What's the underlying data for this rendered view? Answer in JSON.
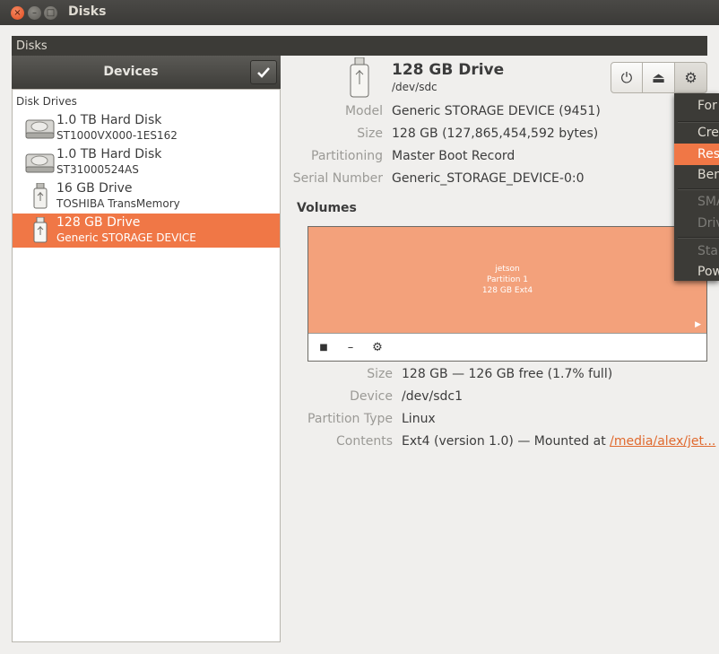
{
  "window": {
    "title": "Disks",
    "close_glyph": "×",
    "min_glyph": "–",
    "max_glyph": "□"
  },
  "menubar": {
    "app_label": "Disks"
  },
  "devices": {
    "header": "Devices",
    "section_label": "Disk Drives",
    "items": [
      {
        "name": "1.0 TB Hard Disk",
        "sub": "ST1000VX000-1ES162",
        "icon": "hard-disk-icon"
      },
      {
        "name": "1.0 TB Hard Disk",
        "sub": "ST31000524AS",
        "icon": "hard-disk-icon"
      },
      {
        "name": "16 GB Drive",
        "sub": "TOSHIBA TransMemory",
        "icon": "usb-drive-icon"
      },
      {
        "name": "128 GB Drive",
        "sub": "Generic STORAGE DEVICE",
        "icon": "usb-drive-icon",
        "selected": true
      }
    ]
  },
  "drive": {
    "title": "128 GB Drive",
    "path": "/dev/sdc",
    "fields": [
      {
        "label": "Model",
        "value": "Generic STORAGE DEVICE (9451)"
      },
      {
        "label": "Size",
        "value": "128 GB (127,865,454,592 bytes)"
      },
      {
        "label": "Partitioning",
        "value": "Master Boot Record"
      },
      {
        "label": "Serial Number",
        "value": "Generic_STORAGE_DEVICE-0:0"
      }
    ]
  },
  "toolbar": {
    "power_glyph": "⏻",
    "eject_glyph": "⏏",
    "gear_glyph": "⚙"
  },
  "volumes": {
    "title": "Volumes",
    "partition": {
      "name": "jetson",
      "label": "Partition 1",
      "fs": "128 GB Ext4",
      "arrow": "▶"
    },
    "tools": {
      "stop": "■",
      "minus": "–",
      "gear": "⚙"
    },
    "fields": [
      {
        "label": "Size",
        "value": "128 GB — 126 GB free (1.7% full)"
      },
      {
        "label": "Device",
        "value": "/dev/sdc1"
      },
      {
        "label": "Partition Type",
        "value": "Linux"
      },
      {
        "label": "Contents",
        "value": "Ext4 (version 1.0) — Mounted at ",
        "link": "/media/alex/jet..."
      }
    ]
  },
  "popup_menu": {
    "items": [
      "For",
      "Cre",
      "Res",
      "Ben",
      "SMA",
      "Driv",
      "Star",
      "Pow"
    ],
    "highlight_color": "#f07746"
  },
  "colors": {
    "accent": "#f07746",
    "partition_fill": "#f3a17b",
    "dark_bar": "#3c3b37"
  }
}
